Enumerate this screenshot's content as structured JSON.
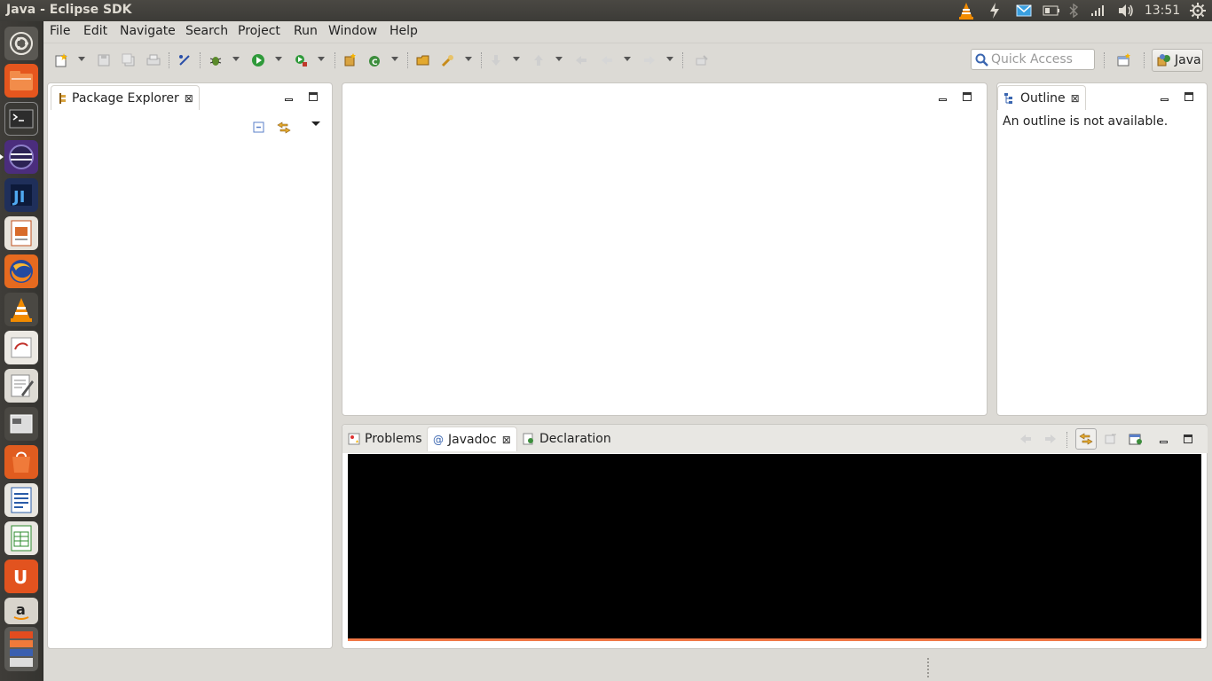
{
  "window": {
    "title": "Java - Eclipse SDK"
  },
  "top_panel": {
    "clock": "13:51"
  },
  "menu": [
    "File",
    "Edit",
    "Navigate",
    "Search",
    "Project",
    "Run",
    "Window",
    "Help"
  ],
  "toolbar": {
    "quick_access_placeholder": "Quick Access",
    "perspective_label": "Java"
  },
  "package_explorer": {
    "tab_label": "Package Explorer"
  },
  "outline": {
    "tab_label": "Outline",
    "message": "An outline is not available."
  },
  "bottom_panel": {
    "tabs": [
      {
        "label": "Problems"
      },
      {
        "label": "Javadoc"
      },
      {
        "label": "Declaration"
      }
    ],
    "active_tab": "Javadoc"
  },
  "colors": {
    "panel_bg": "#3c3b37",
    "ubuntu_orange": "#f07746",
    "eclipse_bg": "#dcdad5"
  },
  "launcher_icons": [
    "ubuntu-dash-icon",
    "files-icon",
    "terminal-icon",
    "eclipse-icon",
    "intellij-icon",
    "libreoffice-impress-icon",
    "firefox-icon",
    "vlc-icon",
    "text-editor-icon",
    "gedit-icon",
    "workspace-icon",
    "software-center-icon",
    "writer-icon",
    "calc-icon",
    "ubuntu-one-icon",
    "amazon-icon",
    "trash-icon"
  ]
}
